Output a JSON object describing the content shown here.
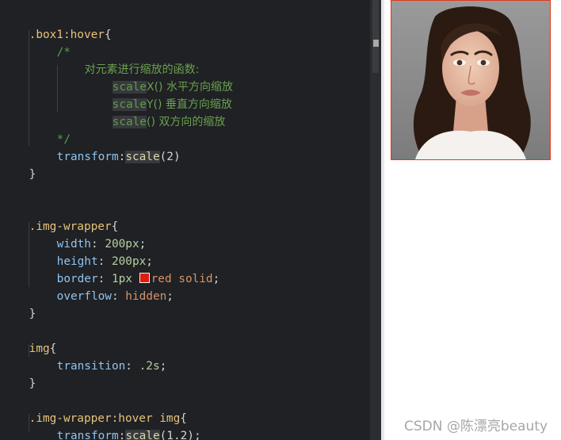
{
  "editor": {
    "code": {
      "l1": {
        "selector": ".box1:hover",
        "open": "{"
      },
      "l2": {
        "text": "/*"
      },
      "l3": {
        "text": "对元素进行缩放的函数:"
      },
      "l4": {
        "hl": "scale",
        "rest": "X() 水平方向缩放"
      },
      "l5": {
        "hl": "scale",
        "rest": "Y() 垂直方向缩放"
      },
      "l6": {
        "hl": "scale",
        "rest": "() 双方向的缩放"
      },
      "l7": {
        "text": "*/"
      },
      "l8": {
        "prop": "transform",
        "colon": ":",
        "fn": "scale",
        "args": "(2)"
      },
      "l9": {
        "close": "}"
      },
      "l12": {
        "selector": ".img-wrapper",
        "open": "{"
      },
      "l13": {
        "prop": "width",
        "colon": ": ",
        "num": "200px",
        "semi": ";"
      },
      "l14": {
        "prop": "height",
        "colon": ": ",
        "num": "200px",
        "semi": ";"
      },
      "l15": {
        "prop": "border",
        "colon": ": ",
        "num": "1px ",
        "val": "red solid",
        "semi": ";"
      },
      "l16": {
        "prop": "overflow",
        "colon": ": ",
        "val": "hidden",
        "semi": ";"
      },
      "l17": {
        "close": "}"
      },
      "l19": {
        "selector": "img",
        "open": "{"
      },
      "l20": {
        "prop": "transition",
        "colon": ": ",
        "num": ".2s",
        "semi": ";"
      },
      "l21": {
        "close": "}"
      },
      "l23": {
        "selector": ".img-wrapper:hover img",
        "open": "{"
      },
      "l24": {
        "prop": "transform",
        "colon": ":",
        "fn": "scale",
        "args": "(1.2);"
      },
      "l25": {
        "close": "}"
      }
    },
    "swatch_color": "#e01b10"
  },
  "preview": {
    "image": "portrait-photo",
    "border_color": "#d93a1f"
  },
  "watermark": "CSDN @陈漂亮beauty"
}
